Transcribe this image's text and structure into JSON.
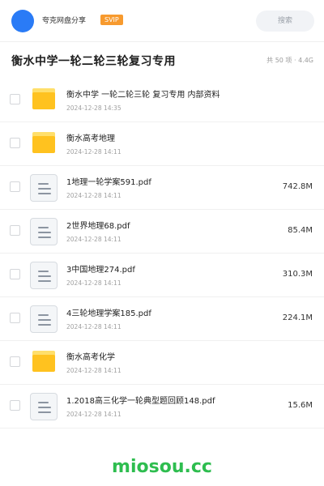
{
  "header": {
    "username": "夸克网盘分享",
    "vip_label": "SVIP",
    "search_placeholder": "搜索"
  },
  "title_bar": {
    "title": "衡水中学一轮二轮三轮复习专用",
    "summary": "共 50 项 · 4.4G"
  },
  "files": [
    {
      "type": "folder",
      "name": "衡水中学 一轮二轮三轮 复习专用 内部资料",
      "date": "2024-12-28 14:35",
      "size": ""
    },
    {
      "type": "folder",
      "name": "衡水高考地理",
      "date": "2024-12-28 14:11",
      "size": ""
    },
    {
      "type": "file",
      "name": "1地理一轮学案591.pdf",
      "date": "2024-12-28 14:11",
      "size": "742.8M"
    },
    {
      "type": "file",
      "name": "2世界地理68.pdf",
      "date": "2024-12-28 14:11",
      "size": "85.4M"
    },
    {
      "type": "file",
      "name": "3中国地理274.pdf",
      "date": "2024-12-28 14:11",
      "size": "310.3M"
    },
    {
      "type": "file",
      "name": "4三轮地理学案185.pdf",
      "date": "2024-12-28 14:11",
      "size": "224.1M"
    },
    {
      "type": "folder",
      "name": "衡水高考化学",
      "date": "2024-12-28 14:11",
      "size": ""
    },
    {
      "type": "file",
      "name": "1.2018高三化学一轮典型题回顾148.pdf",
      "date": "2024-12-28 14:11",
      "size": "15.6M"
    }
  ],
  "watermark": "miosou.cc",
  "colors": {
    "avatar": "#2a7bf6",
    "vip_badge": "#f79a2e",
    "folder": "#ffc21f",
    "watermark": "#2ebd4f"
  }
}
